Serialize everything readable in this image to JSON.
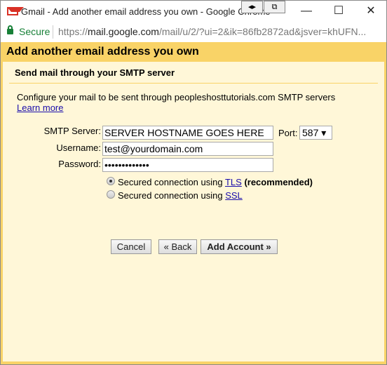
{
  "window": {
    "title": "Gmail - Add another email address you own - Google Chrome",
    "snap_left": "◂▸",
    "snap_right": "⧉",
    "minimize": "—",
    "maximize": "☐",
    "close": "✕"
  },
  "address": {
    "secure_label": "Secure",
    "url_scheme": "https://",
    "url_host": "mail.google.com",
    "url_path": "/mail/u/2/?ui=2&ik=86fb2872ad&jsver=khUFN..."
  },
  "page": {
    "title": "Add another email address you own",
    "subtitle": "Send mail through your SMTP server",
    "description": "Configure your mail to be sent through peopleshosttutorials.com SMTP servers",
    "learn_more": "Learn more",
    "smtp_label": "SMTP Server:",
    "smtp_value": "SERVER HOSTNAME GOES HERE",
    "port_label": "Port:",
    "port_value": "587 ▾",
    "username_label": "Username:",
    "username_value": "test@yourdomain.com",
    "password_label": "Password:",
    "password_value": "•••••••••••••",
    "tls_prefix": "Secured connection using ",
    "tls_link": "TLS",
    "tls_suffix": " (recommended)",
    "ssl_prefix": "Secured connection using ",
    "ssl_link": "SSL",
    "selected_security": "TLS",
    "cancel": "Cancel",
    "back": "« Back",
    "add_account": "Add Account »"
  },
  "colors": {
    "frame": "#f9d367",
    "panel": "#fff7d8",
    "link": "#1a0dab",
    "secure": "#188038"
  }
}
